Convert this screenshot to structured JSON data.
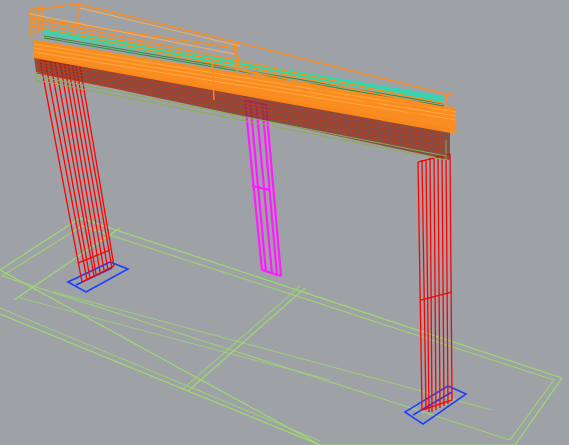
{
  "viewport": {
    "background": "#9ea2a7",
    "grid_color": "#9edd6a",
    "column_color": "#ff0000",
    "beam_color": "#ff8c1a",
    "accent_stripe_color": "#33d6b0",
    "hanger_color": "#ff1aff",
    "footplate_color": "#1a3fff"
  }
}
